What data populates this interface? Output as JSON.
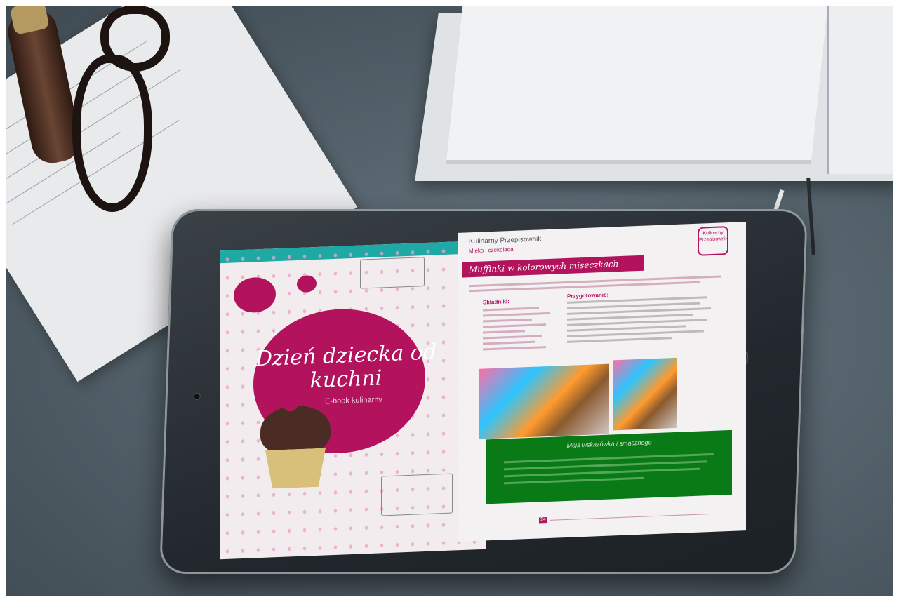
{
  "cover": {
    "title": "Dzień dziecka od kuchni",
    "subtitle": "E-book kulinarny"
  },
  "recipe_page": {
    "header": "Kulinarny Przepisownik",
    "category": "Mleko i czekolada",
    "badge": "Kulinarny Przepisownik",
    "recipe_title": "Muffinki w kolorowych miseczkach",
    "ingredients_heading": "Składniki:",
    "preparation_heading": "Przygotowanie:",
    "tip_title": "Moja wskazówka i smacznego",
    "page_number": "24"
  },
  "colors": {
    "magenta": "#b3135d",
    "teal": "#1fa9a5",
    "green": "#0a7a17"
  }
}
